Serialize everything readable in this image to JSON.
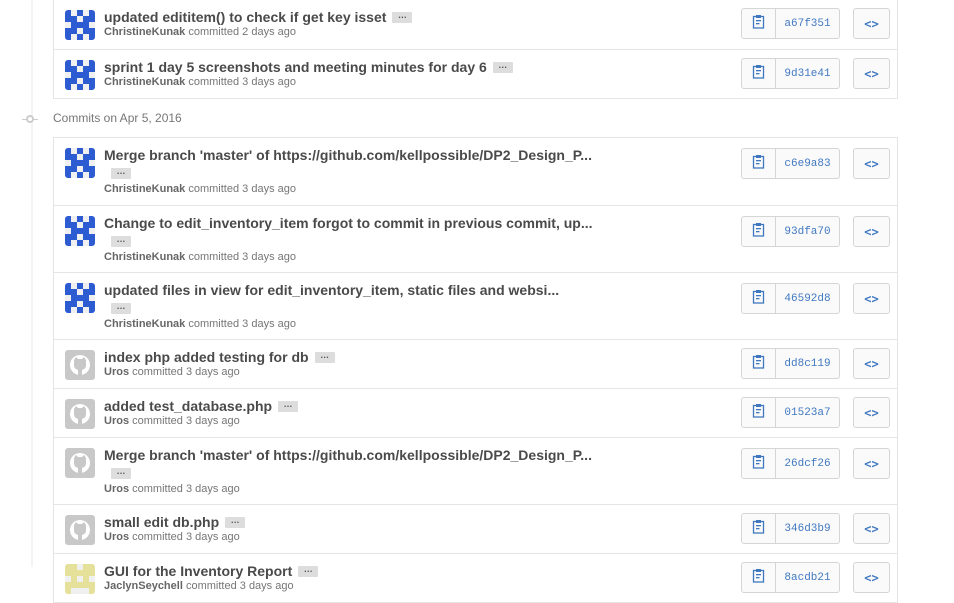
{
  "group_header": {
    "label": "Commits on Apr 5, 2016"
  },
  "group_top": [
    {
      "message": "updated edititem() to check if get key isset",
      "author": "ChristineKunak",
      "action": "committed",
      "when": "2 days ago",
      "sha": "a67f351",
      "avatar": "identicon-blue"
    },
    {
      "message": "sprint 1 day 5 screenshots and meeting minutes for day 6",
      "author": "ChristineKunak",
      "action": "committed",
      "when": "3 days ago",
      "sha": "9d31e41",
      "avatar": "identicon-blue"
    }
  ],
  "group_apr5": [
    {
      "message": "Merge branch 'master' of https://github.com/kellpossible/DP2_Design_P...",
      "author": "ChristineKunak",
      "action": "committed",
      "when": "3 days ago",
      "sha": "c6e9a83",
      "avatar": "identicon-blue"
    },
    {
      "message": "Change to edit_inventory_item forgot to commit in previous commit, up...",
      "author": "ChristineKunak",
      "action": "committed",
      "when": "3 days ago",
      "sha": "93dfa70",
      "avatar": "identicon-blue"
    },
    {
      "message": "updated files in view for edit_inventory_item, static files and websi...",
      "author": "ChristineKunak",
      "action": "committed",
      "when": "3 days ago",
      "sha": "46592d8",
      "avatar": "identicon-blue"
    },
    {
      "message": "index php added testing for db",
      "author": "Uros",
      "action": "committed",
      "when": "3 days ago",
      "sha": "dd8c119",
      "avatar": "octocat-gray"
    },
    {
      "message": "added test_database.php",
      "author": "Uros",
      "action": "committed",
      "when": "3 days ago",
      "sha": "01523a7",
      "avatar": "octocat-gray"
    },
    {
      "message": "Merge branch 'master' of https://github.com/kellpossible/DP2_Design_P...",
      "author": "Uros",
      "action": "committed",
      "when": "3 days ago",
      "sha": "26dcf26",
      "avatar": "octocat-gray"
    },
    {
      "message": "small edit db.php",
      "author": "Uros",
      "action": "committed",
      "when": "3 days ago",
      "sha": "346d3b9",
      "avatar": "octocat-gray"
    },
    {
      "message": "GUI for the Inventory Report",
      "author": "JaclynSeychell",
      "action": "committed",
      "when": "3 days ago",
      "sha": "8acdb21",
      "avatar": "identicon-yellow"
    }
  ],
  "icons": {
    "ellipsis": "…",
    "clipboard": "clipboard-icon",
    "browse": "<>"
  },
  "colors": {
    "identicon_blue": "#2d5bd1",
    "identicon_yellow": "#e5e09a",
    "sha_link": "#4078c0"
  }
}
